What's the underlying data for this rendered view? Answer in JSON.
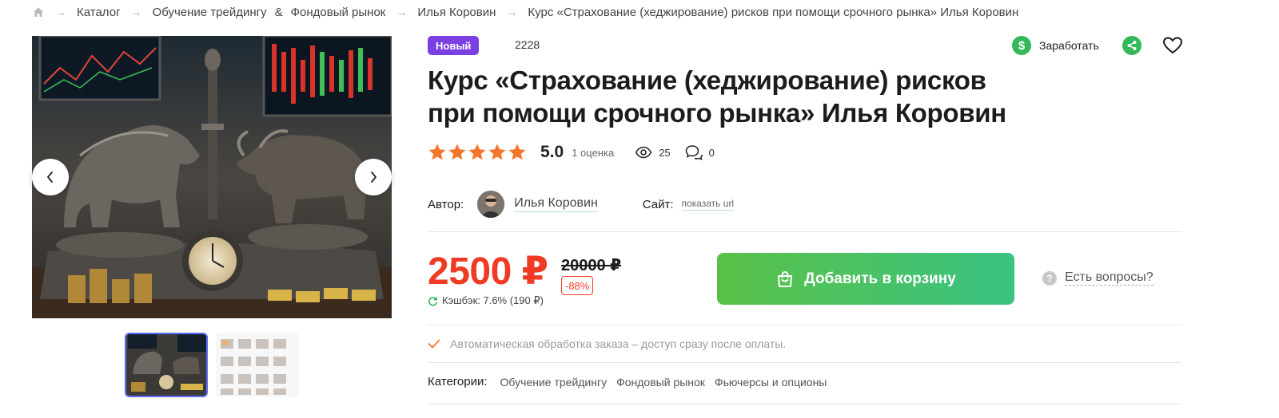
{
  "breadcrumb": {
    "home_icon": "home-icon",
    "items": [
      "Каталог",
      "Обучение трейдингу",
      "&",
      "Фондовый рынок",
      "Илья Коровин",
      "Курс «Страхование (хеджирование) рисков при помощи срочного рынка» Илья Коровин"
    ]
  },
  "product": {
    "badge": "Новый",
    "id": "2228",
    "title_line1": "Курс «Страхование (хеджирование) рисков",
    "title_line2": "при помощи срочного рынка» Илья Коровин",
    "rating": "5.0",
    "stars": 5,
    "rating_count": "1 оценка",
    "views": "25",
    "comments": "0"
  },
  "actions": {
    "earn_label": "Заработать",
    "earn_icon": "dollar-coin-icon",
    "share_icon": "share-icon",
    "favorite_icon": "heart-icon"
  },
  "author": {
    "label": "Автор:",
    "name": "Илья Коровин",
    "site_label": "Сайт:",
    "site_link": "показать url"
  },
  "pricing": {
    "price": "2500 ₽",
    "old_price": "20000 ₽",
    "discount": "-88%",
    "cashback": "Кэшбэк: 7.6% (190 ₽)"
  },
  "cart": {
    "button_label": "Добавить в корзину",
    "questions_label": "Есть вопросы?"
  },
  "info": {
    "auto_processing": "Автоматическая обработка заказа – доступ сразу после оплаты."
  },
  "categories": {
    "label": "Категории:",
    "items": [
      "Обучение трейдингу",
      "Фондовый рынок",
      "Фьючерсы и опционы"
    ]
  },
  "colors": {
    "accent_green": "#34b85a",
    "badge_purple": "#7b3fe4",
    "price_red": "#ef3b24",
    "star_orange": "#f2772c"
  }
}
